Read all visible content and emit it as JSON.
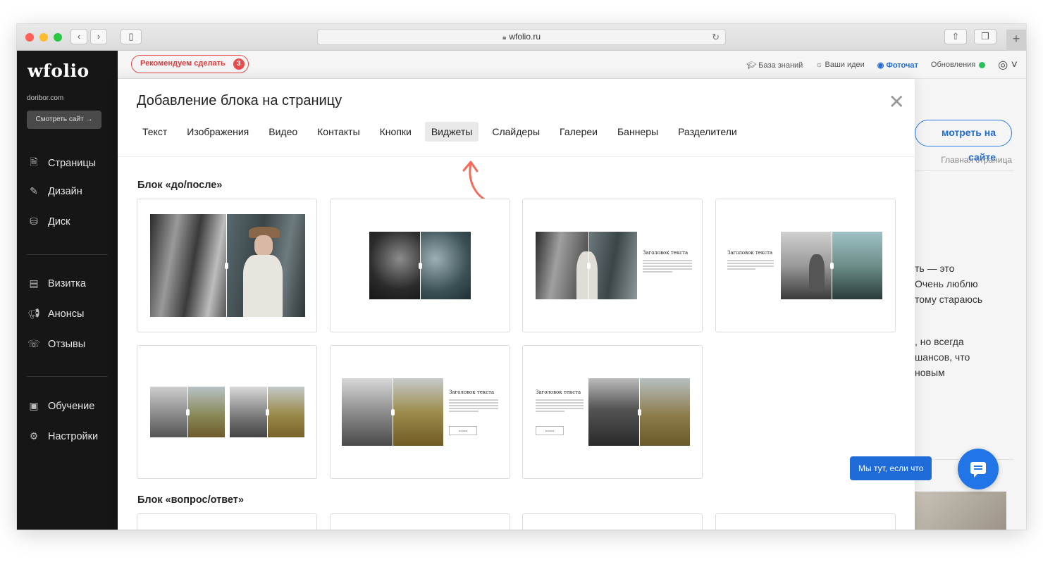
{
  "browser": {
    "url": "wfolio.ru"
  },
  "sidebar": {
    "logo": "wfolio",
    "domain": "doribor.com",
    "view_site": "Смотреть сайт →",
    "items": [
      {
        "label": "Страницы",
        "icon": "page-icon"
      },
      {
        "label": "Дизайн",
        "icon": "brush-icon"
      },
      {
        "label": "Диск",
        "icon": "database-icon"
      },
      {
        "label": "Визитка",
        "icon": "card-icon"
      },
      {
        "label": "Анонсы",
        "icon": "megaphone-icon"
      },
      {
        "label": "Отзывы",
        "icon": "chat-icon"
      },
      {
        "label": "Обучение",
        "icon": "book-icon"
      },
      {
        "label": "Настройки",
        "icon": "gear-icon"
      }
    ]
  },
  "topbar": {
    "recommend_label": "Рекомендуем сделать",
    "recommend_count": "3",
    "knowledge": "База знаний",
    "ideas": "Ваши идеи",
    "photochat": "Фоточат",
    "updates": "Обновления"
  },
  "background": {
    "see_on_site": "мотреть на сайте",
    "breadcrumb": "Главная страница",
    "para1": "ть — это\nОчень люблю\nтому стараюсь",
    "para2": ", но всегда\nшансов, что\nновым"
  },
  "modal": {
    "title": "Добавление блока на страницу",
    "tabs": [
      "Текст",
      "Изображения",
      "Видео",
      "Контакты",
      "Кнопки",
      "Виджеты",
      "Слайдеры",
      "Галереи",
      "Баннеры",
      "Разделители"
    ],
    "active_tab": "Виджеты",
    "section1": "Блок «до/после»",
    "section2": "Блок «вопрос/ответ»",
    "preview_heading": "Заголовок текста",
    "preview_button": "кнопка"
  },
  "chat": {
    "label": "Мы тут, если что"
  },
  "colors": {
    "accent": "#1f6bd8",
    "recommend": "#e94b4b",
    "sidebar": "#161616",
    "arrow": "#f26b5b"
  }
}
